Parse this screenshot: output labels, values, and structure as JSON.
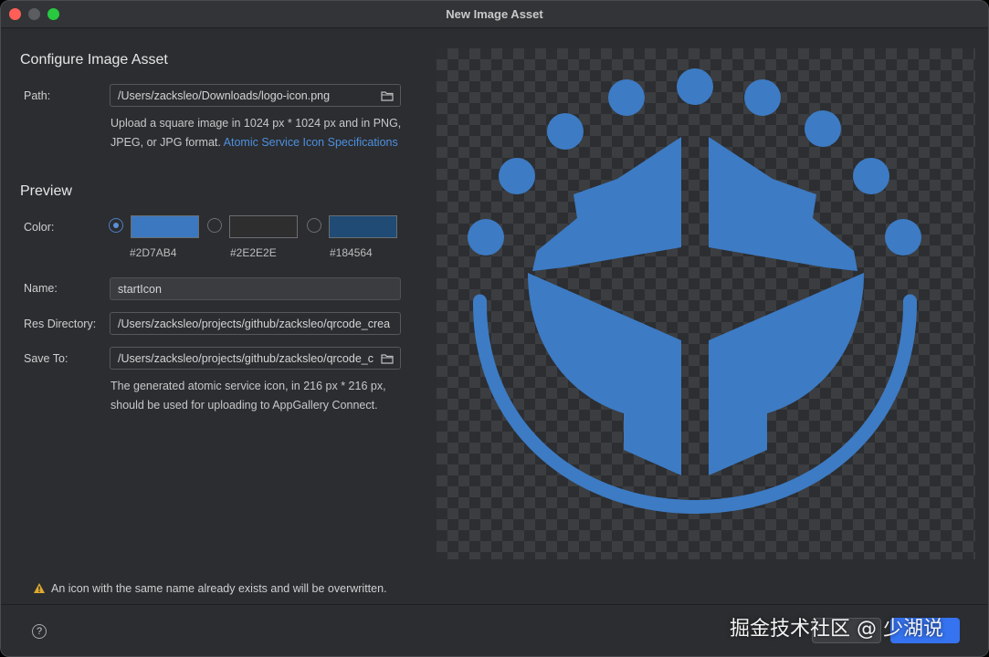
{
  "window": {
    "title": "New Image Asset"
  },
  "configure": {
    "heading": "Configure Image Asset",
    "path_label": "Path:",
    "path_value": "/Users/zacksleo/Downloads/logo-icon.png",
    "hint_line1": "Upload a square image in 1024 px * 1024 px and in PNG,",
    "hint_line2_prefix": "JPEG, or JPG format.",
    "hint_link": "Atomic Service Icon Specifications"
  },
  "preview": {
    "heading": "Preview",
    "color_label": "Color:",
    "colors": [
      {
        "label": "#2D7AB4",
        "hex": "#3c78bf",
        "selected": true
      },
      {
        "label": "#2E2E2E",
        "hex": "#2e2e2e",
        "selected": false
      },
      {
        "label": "#184564",
        "hex": "#1f4b74",
        "selected": false
      }
    ],
    "name_label": "Name:",
    "name_value": "startIcon",
    "res_dir_label": "Res Directory:",
    "res_dir_value": "/Users/zacksleo/projects/github/zacksleo/qrcode_crea",
    "save_to_label": "Save To:",
    "save_to_value": "/Users/zacksleo/projects/github/zacksleo/qrcode_c",
    "note_line1": "The generated atomic service icon, in 216 px * 216 px,",
    "note_line2": "should be used for uploading to AppGallery Connect."
  },
  "warning": {
    "text": "An icon with the same name already exists and will be overwritten."
  },
  "footer": {
    "help": "?",
    "cancel_label": "",
    "finish_label": ""
  },
  "watermark": "掘金技术社区 @ 少湖说",
  "icons": {
    "folder": "folder-icon",
    "warning": "warning-icon",
    "help": "help-icon"
  },
  "accent": "#3d7bc4"
}
